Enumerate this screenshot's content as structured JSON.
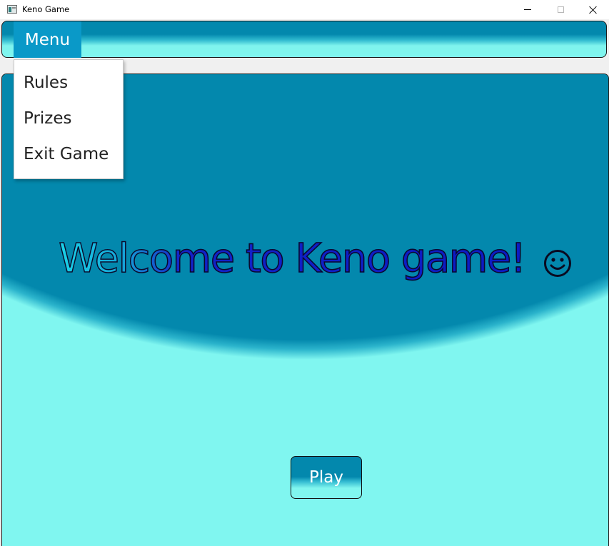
{
  "window": {
    "title": "Keno Game",
    "icon": "app-window-icon"
  },
  "menubar": {
    "menu_label": "Menu"
  },
  "menu_dropdown": {
    "items": [
      {
        "label": "Rules"
      },
      {
        "label": "Prizes"
      },
      {
        "label": "Exit Game"
      }
    ]
  },
  "main": {
    "welcome_text": "Welcome to Keno game!",
    "smiley_icon": "smiley-face-icon",
    "play_label": "Play"
  },
  "colors": {
    "dark_teal": "#0388ad",
    "light_aqua": "#80f6f0",
    "menu_button_bg": "#0a99c8",
    "welcome_text_blue": "#0d1bc4"
  }
}
